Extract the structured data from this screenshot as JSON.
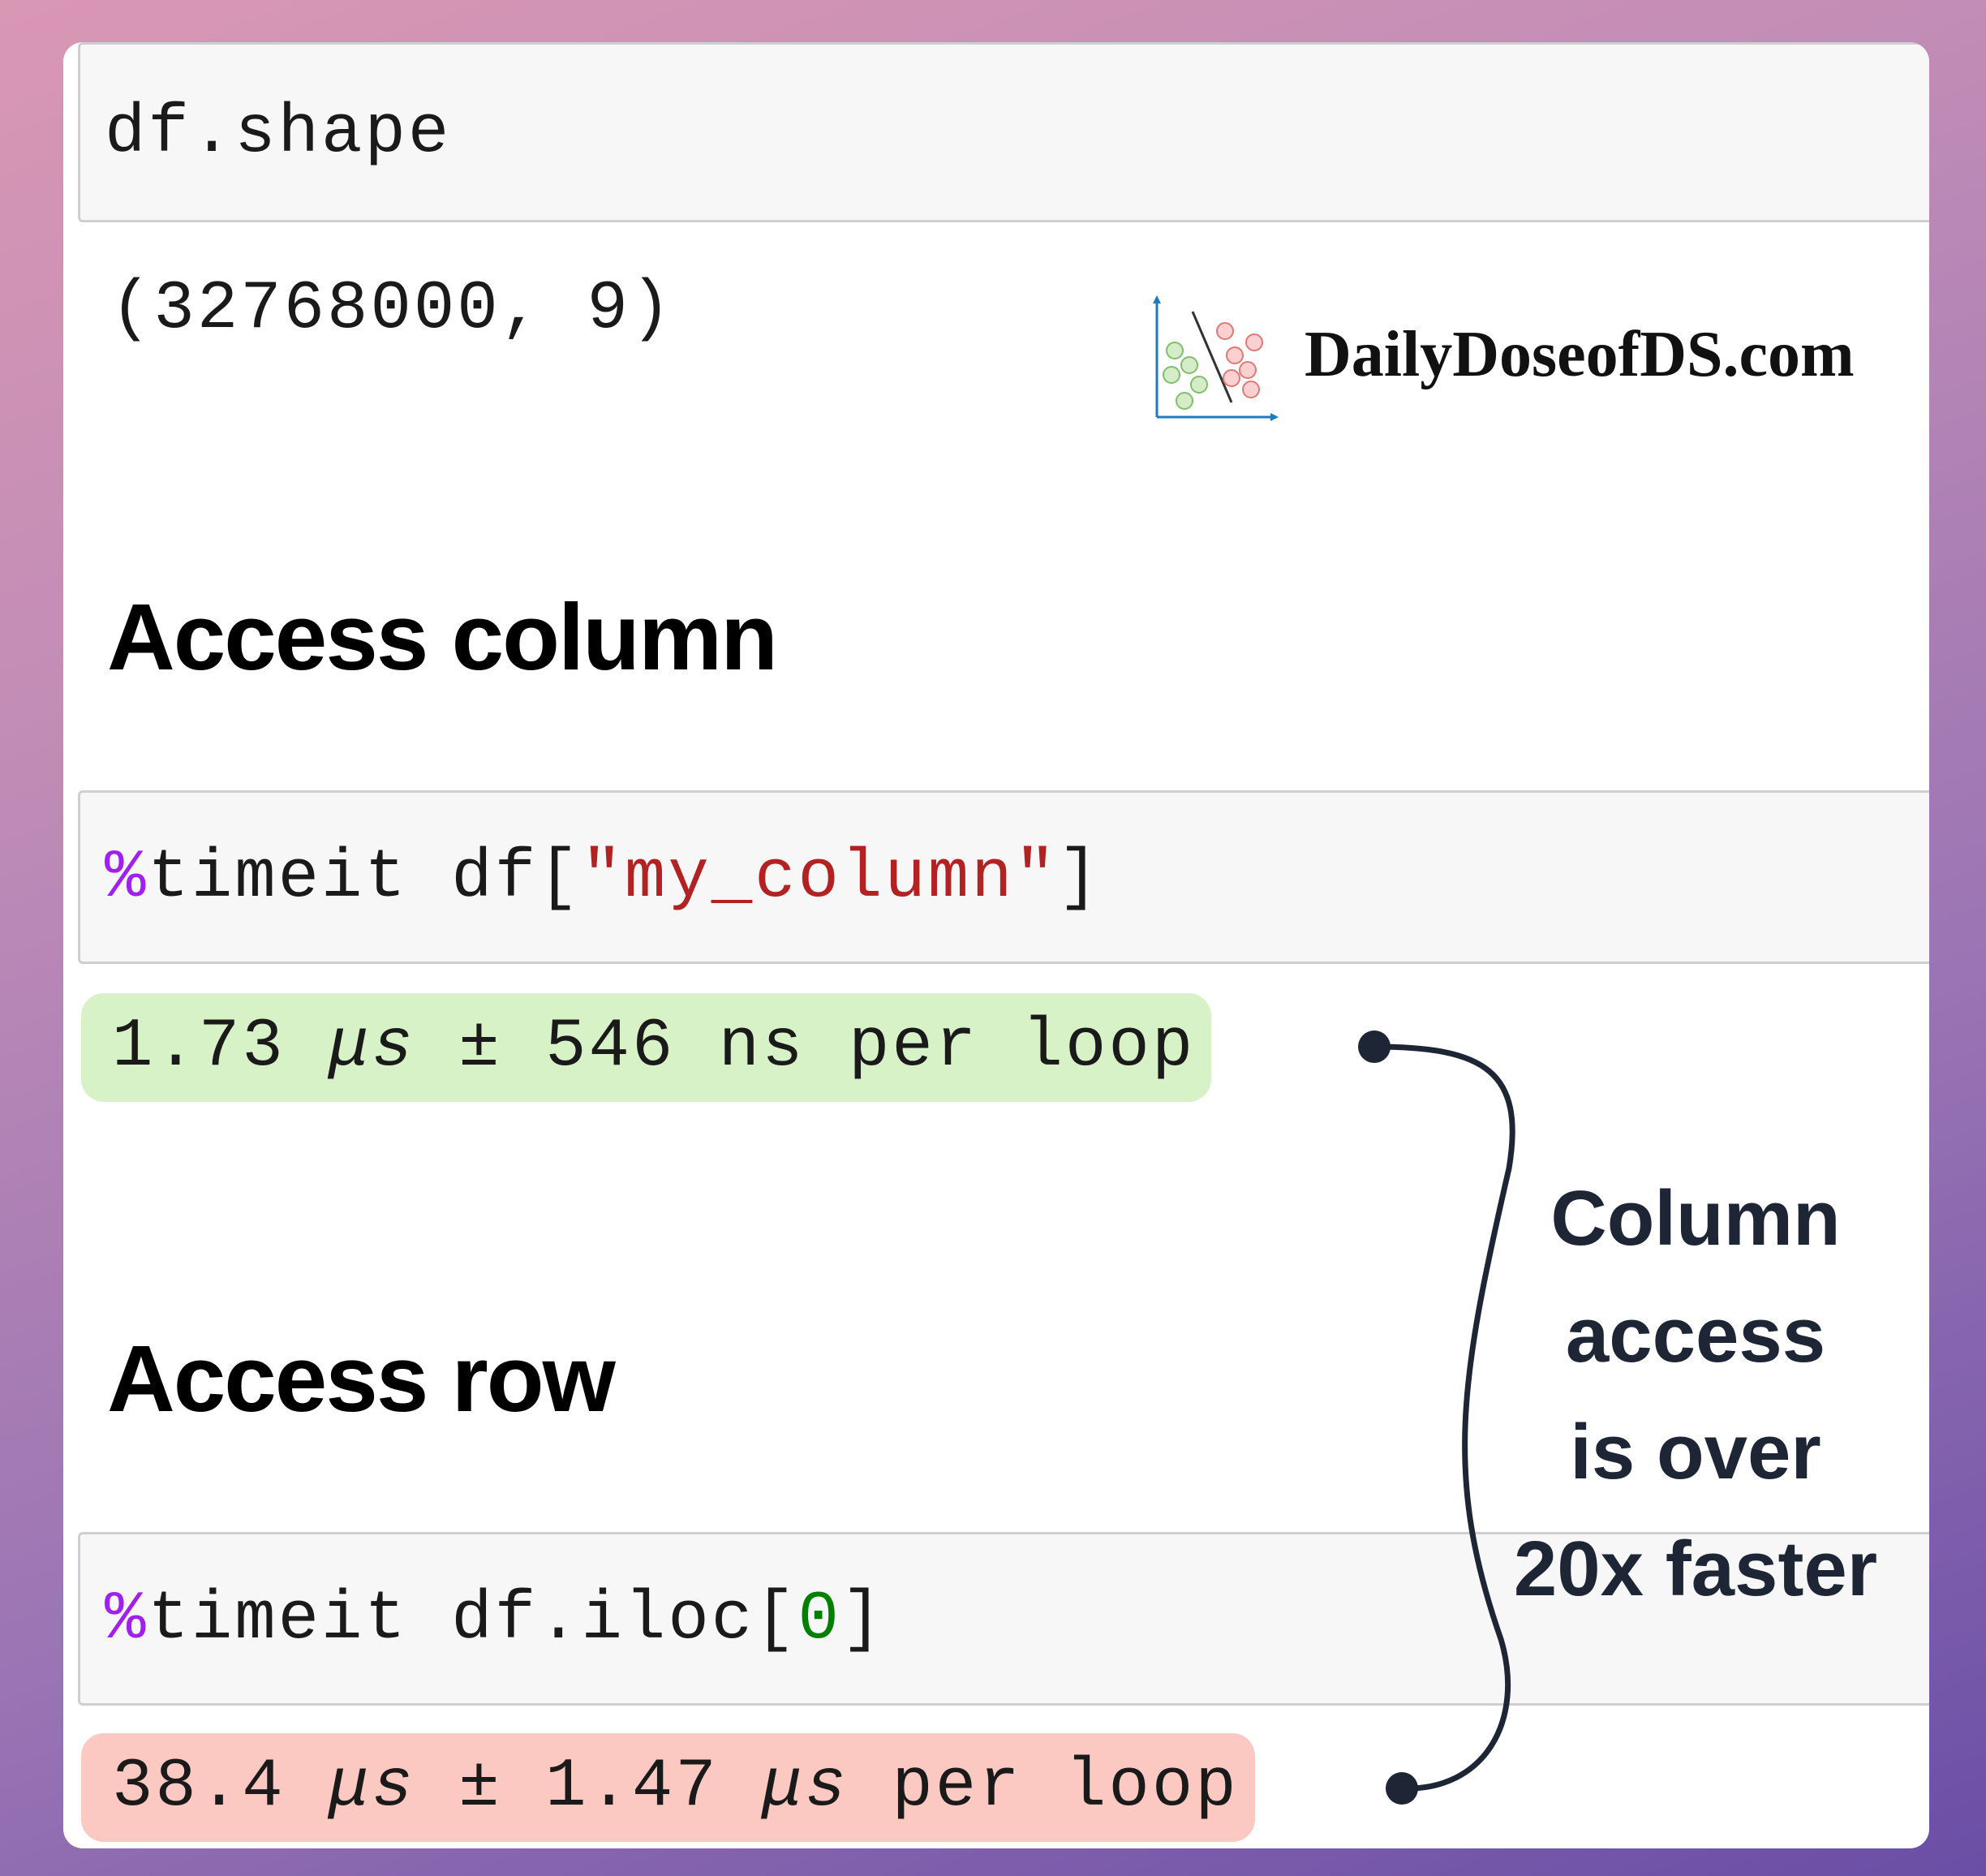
{
  "cells": {
    "shape_cmd": "df.shape",
    "shape_output": "(32768000, 9)",
    "col_magic": "%",
    "col_cmd_pre": "timeit df[",
    "col_str": "\"my_column\"",
    "col_cmd_post": "]",
    "row_magic": "%",
    "row_cmd_pre": "timeit df.iloc[",
    "row_num": "0",
    "row_cmd_post": "]"
  },
  "headings": {
    "column": "Access column",
    "row": "Access row"
  },
  "timings": {
    "column": {
      "value": "1.73 ",
      "unit": "μs",
      "rest": " ± 546 ns per loop"
    },
    "row": {
      "value": "38.4 ",
      "unit1": "μs",
      "mid": " ± 1.47 ",
      "unit2": "μs",
      "rest": " per loop"
    }
  },
  "annotation": {
    "line1": "Column",
    "line2": "access",
    "line3": "is over",
    "line4": "20x faster"
  },
  "brand": {
    "name": "DailyDoseofDS.com",
    "logo_icon": "scatter-classifier-icon"
  },
  "colors": {
    "magic": "#a020f0",
    "string": "#b22222",
    "number": "#008000",
    "fast_bg": "#d8f2c8",
    "slow_bg": "#fbc9c2"
  }
}
